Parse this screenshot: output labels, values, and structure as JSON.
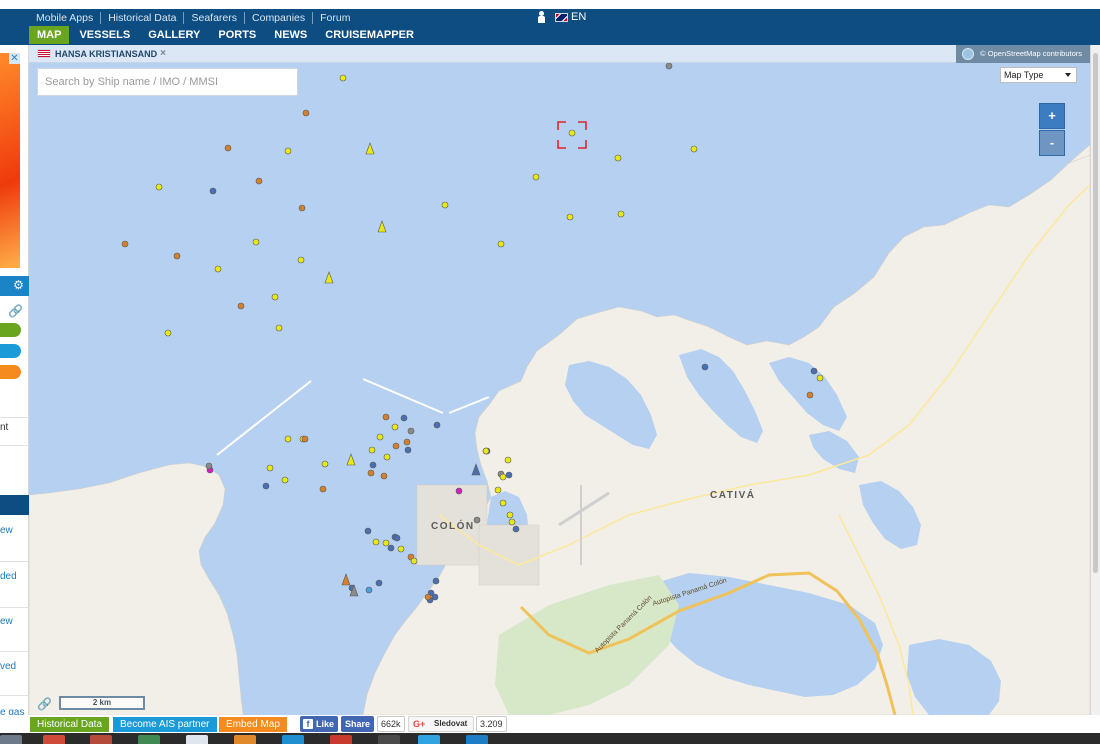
{
  "header": {
    "top_links": [
      "Mobile Apps",
      "Historical Data",
      "Seafarers",
      "Companies",
      "Forum"
    ],
    "language": "EN",
    "nav": [
      "MAP",
      "VESSELS",
      "GALLERY",
      "PORTS",
      "NEWS",
      "CRUISEMAPPER"
    ],
    "active_nav": "MAP"
  },
  "map": {
    "tab_label": "HANSA KRISTIANSAND",
    "tab_close": "×",
    "attribution": "© OpenStreetMap contributors",
    "search_placeholder": "Search by Ship name / IMO / MMSI",
    "map_type_label": "Map Type",
    "zoom_in": "+",
    "zoom_out": "-",
    "scale_label": "2 km",
    "places": [
      "COLÓN",
      "CATIVÁ"
    ],
    "road_labels": [
      "Autopista Panamá Colón",
      "Autopista Panamá Colón"
    ],
    "selected_vessel_marker": "yellow",
    "vessel_colors": {
      "yellow": "#e8e816",
      "orange": "#d2802e",
      "blue": "#4a6fb0",
      "grey": "#8a8a8a",
      "magenta": "#d020c0",
      "lightblue": "#4aa0d8"
    }
  },
  "left_panel": {
    "fragments": [
      "nt",
      "ew",
      "ded",
      "ew",
      "ved",
      "e gas"
    ]
  },
  "bottom_bar": {
    "historical_data": "Historical Data",
    "become_partner": "Become AIS partner",
    "embed_map": "Embed Map",
    "fb_like": "Like",
    "fb_share": "Share",
    "fb_count": "662k",
    "gplus_label": "Sledovat",
    "gplus_count": "3.209"
  },
  "colors": {
    "header_bg": "#0d4d82",
    "active_nav": "#6aa520",
    "water": "#b5d0f0",
    "land": "#f2efe9"
  }
}
